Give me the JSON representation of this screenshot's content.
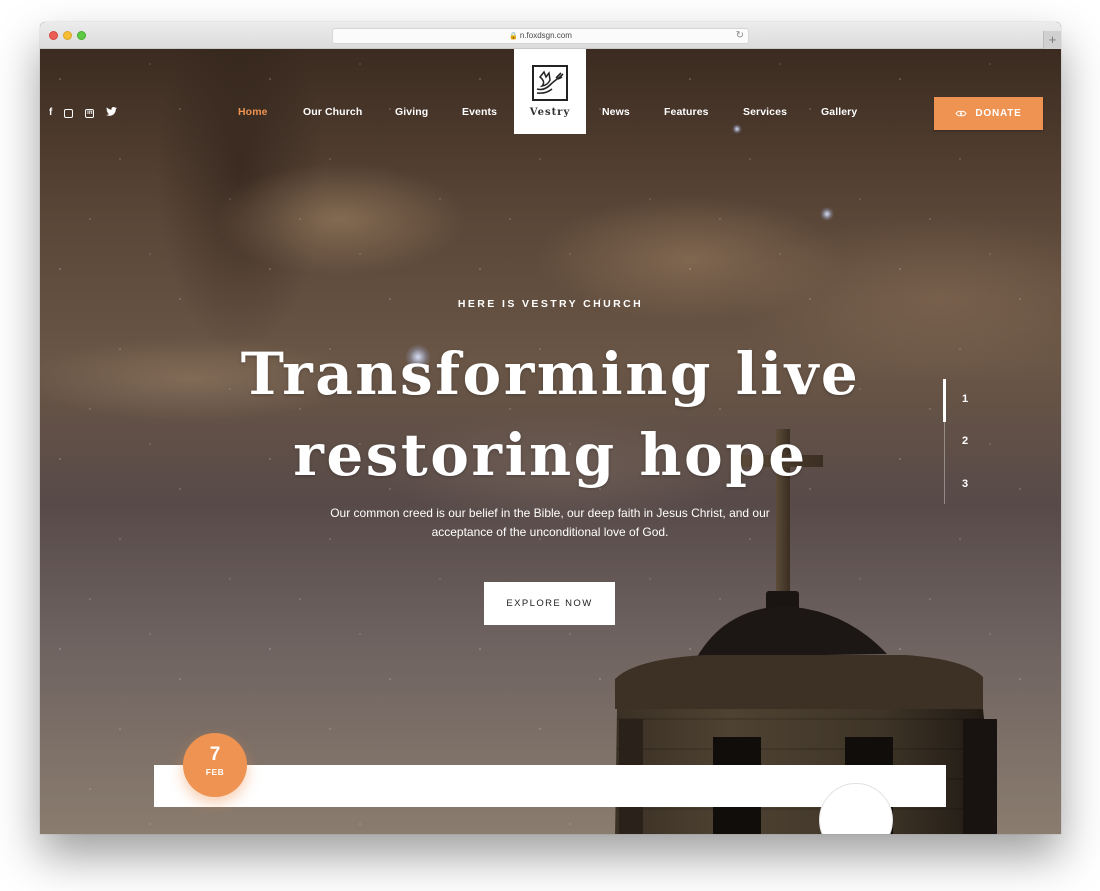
{
  "browser": {
    "url": "n.foxdsgn.com",
    "new_tab_label": "+"
  },
  "site": {
    "logo_text": "Vestry",
    "social": [
      {
        "icon": "facebook-icon",
        "glyph": "f"
      },
      {
        "icon": "instagram-icon",
        "glyph": "◎"
      },
      {
        "icon": "linkedin-icon",
        "glyph": "in"
      },
      {
        "icon": "twitter-icon",
        "glyph": "🐦"
      }
    ],
    "nav_left": [
      {
        "label": "Home",
        "active": true
      },
      {
        "label": "Our Church",
        "active": false
      },
      {
        "label": "Giving",
        "active": false
      },
      {
        "label": "Events",
        "active": false
      }
    ],
    "nav_right": [
      {
        "label": "News",
        "active": false
      },
      {
        "label": "Features",
        "active": false
      },
      {
        "label": "Services",
        "active": false
      },
      {
        "label": "Gallery",
        "active": false
      }
    ],
    "donate_label": "DONATE",
    "accent_color": "#ee9351"
  },
  "hero": {
    "eyebrow": "HERE IS VESTRY CHURCH",
    "headline_line1": "Transforming live",
    "headline_line2": "restoring hope",
    "subtext": "Our common creed is our belief in the Bible, our deep faith in Jesus Christ, and our acceptance of the unconditional love of God.",
    "cta_label": "EXPLORE NOW",
    "slides": [
      "1",
      "2",
      "3"
    ],
    "active_slide": 1
  },
  "event": {
    "day": "7",
    "month": "FEB"
  }
}
